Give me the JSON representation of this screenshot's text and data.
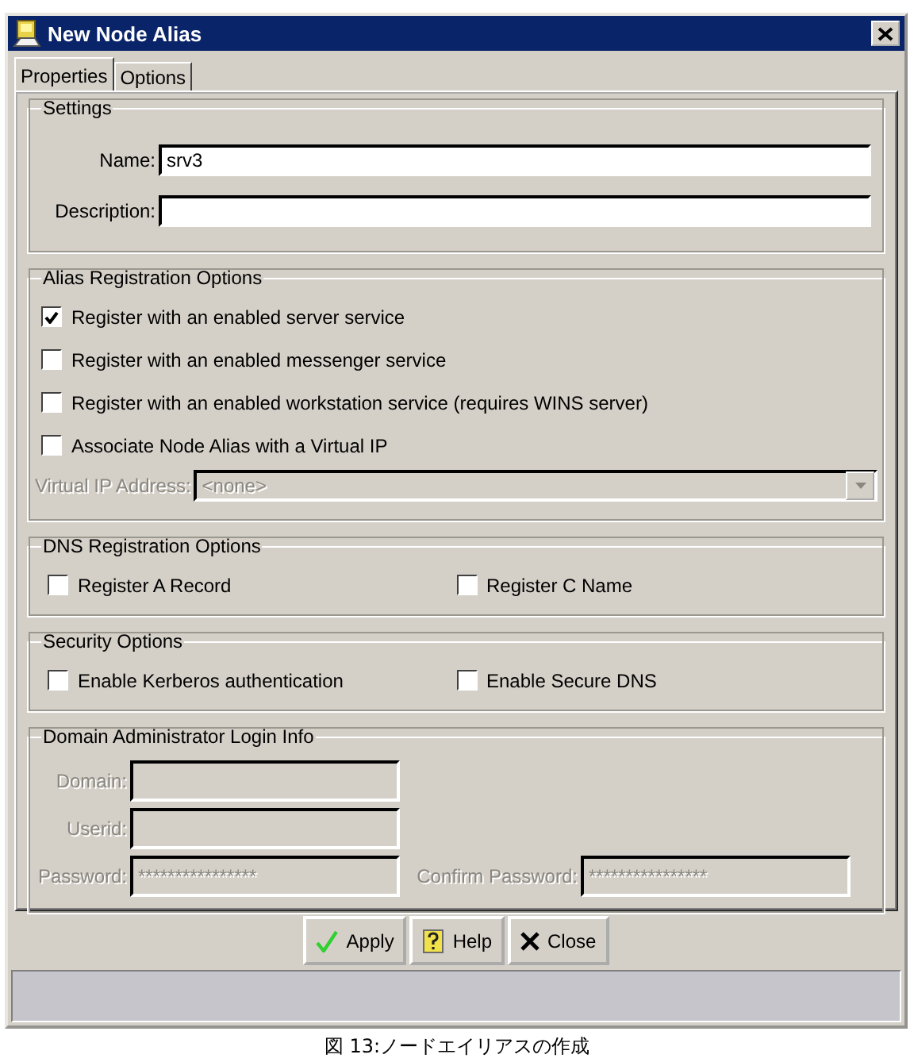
{
  "window": {
    "title": "New Node Alias"
  },
  "tabs": [
    {
      "label": "Properties",
      "selected": true
    },
    {
      "label": "Options",
      "selected": false
    }
  ],
  "settings": {
    "title": "Settings",
    "fields": [
      {
        "label": "Name:",
        "value": "srv3"
      },
      {
        "label": "Description:"
      }
    ]
  },
  "alias_registration": {
    "title": "Alias Registration Options",
    "checkboxes": [
      {
        "label": "Register with an enabled server service",
        "checked": true
      },
      {
        "label": "Register with an enabled messenger service",
        "checked": false
      },
      {
        "label": "Register with an enabled workstation service (requires WINS server)",
        "checked": false
      },
      {
        "label": "Associate Node Alias with a Virtual IP",
        "checked": false
      }
    ],
    "virtual_ip": {
      "label": "Virtual IP Address:",
      "value": "<none>",
      "disabled": true
    }
  },
  "dns_registration": {
    "title": "DNS Registration Options",
    "checkboxes": [
      {
        "label": "Register A Record",
        "checked": false
      },
      {
        "label": "Register C Name",
        "checked": false
      }
    ]
  },
  "security": {
    "title": "Security Options",
    "checkboxes": [
      {
        "label": "Enable Kerberos authentication",
        "checked": false
      },
      {
        "label": "Enable Secure DNS",
        "checked": false
      }
    ]
  },
  "domain_login": {
    "title": "Domain Administrator Login Info",
    "disabled": true,
    "fields": [
      {
        "label": "Domain:"
      },
      {
        "label": "Userid:"
      },
      {
        "label": "Password:",
        "value": "****************"
      },
      {
        "label": "Confirm Password:",
        "value": "****************"
      }
    ]
  },
  "buttons": [
    {
      "label": "Apply",
      "kind": "apply"
    },
    {
      "label": "Help",
      "kind": "help"
    },
    {
      "label": "Close",
      "kind": "close"
    }
  ],
  "caption": "図 13:ノードエイリアスの作成"
}
